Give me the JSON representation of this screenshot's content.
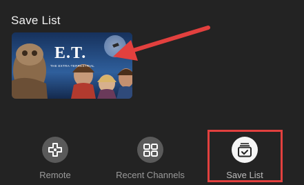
{
  "section": {
    "title": "Save List"
  },
  "poster": {
    "title": "E.T.",
    "subtitle": "THE EXTRA-TERRESTRIAL"
  },
  "nav": {
    "items": [
      {
        "label": "Remote",
        "icon": "gamepad-icon"
      },
      {
        "label": "Recent Channels",
        "icon": "grid-icon"
      },
      {
        "label": "Save List",
        "icon": "saved-list-icon",
        "selected": true
      }
    ]
  },
  "colors": {
    "background": "#232323",
    "annotation_red": "#e2403e",
    "icon_bg": "#5a5a5a",
    "icon_bg_selected": "#f5f5f5"
  }
}
